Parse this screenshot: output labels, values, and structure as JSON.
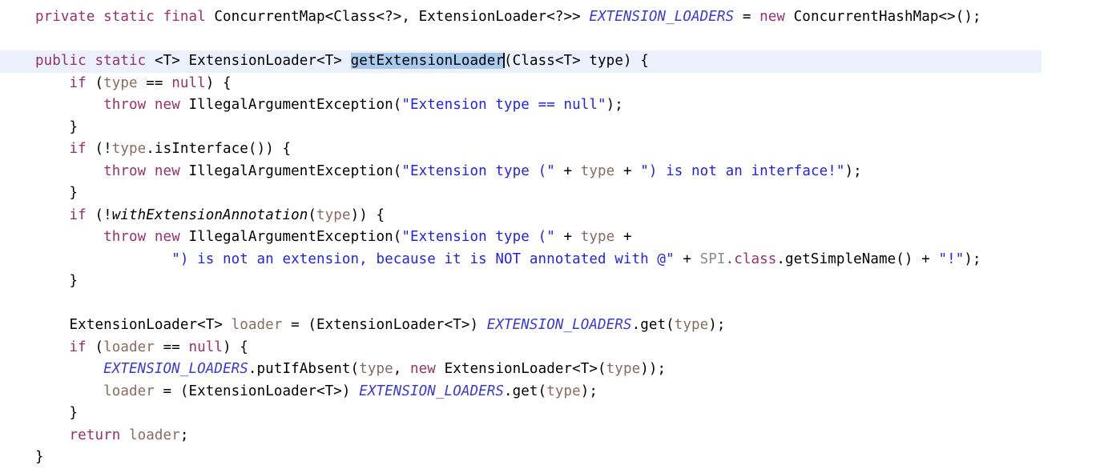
{
  "editor": {
    "language": "java",
    "background_color": "#ffffff",
    "current_line_highlight_color": "#eaf1fb",
    "selection_color": "#a9cbee",
    "caret_color": "#111111",
    "font_size_px": 17.5,
    "colors": {
      "keyword": "#9a2f6a",
      "string": "#2222ee",
      "static_field": "#3b39d6",
      "local_variable": "#8a6a62",
      "class_name": "#000000",
      "constant_class": "#8b8b8b",
      "static_method_italic": "#000000"
    }
  },
  "code": {
    "line1": {
      "kw_private": "private",
      "kw_static": "static",
      "kw_final": "final",
      "type_concurrentmap": "ConcurrentMap<Class<?>, ExtensionLoader<?>>",
      "field_extension_loaders": "EXTENSION_LOADERS",
      "op_assign": "=",
      "kw_new": "new",
      "type_concurrenthashmap": "ConcurrentHashMap<>();"
    },
    "line3": {
      "kw_public": "public",
      "kw_static": "static",
      "generic_t": "<T>",
      "return_type": "ExtensionLoader<T>",
      "method_name": "getExtensionLoader",
      "params": "(Class<T> type) {"
    },
    "line4": {
      "kw_if": "if",
      "open": "(",
      "var_type": "type",
      "op_eq": " == ",
      "kw_null": "null",
      "close": ") {"
    },
    "line5": {
      "kw_throw": "throw",
      "kw_new": "new",
      "exception": "IllegalArgumentException(",
      "string": "\"Extension type == null\"",
      "tail": ");"
    },
    "line6": {
      "close_brace": "}"
    },
    "line7": {
      "kw_if": "if",
      "open": "(!",
      "var_type": "type",
      "call": ".isInterface()) {"
    },
    "line8": {
      "kw_throw": "throw",
      "kw_new": "new",
      "exception": "IllegalArgumentException(",
      "string_a": "\"Extension type (\"",
      "plus1": " + ",
      "var_type": "type",
      "plus2": " + ",
      "string_b": "\") is not an interface!\"",
      "tail": ");"
    },
    "line9": {
      "close_brace": "}"
    },
    "line10": {
      "kw_if": "if",
      "open": "(!",
      "static_method": "withExtensionAnnotation",
      "paren_open": "(",
      "var_type": "type",
      "close": ")) {"
    },
    "line11": {
      "kw_throw": "throw",
      "kw_new": "new",
      "exception": "IllegalArgumentException(",
      "string_a": "\"Extension type (\"",
      "plus1": " + ",
      "var_type": "type",
      "plus2": " +"
    },
    "line12": {
      "string_b": "\") is not an extension, because it is NOT annotated with @\"",
      "plus1": " + ",
      "const_spi": "SPI",
      "kw_class": ".class",
      "call": ".getSimpleName()",
      "plus2": " + ",
      "string_c": "\"!\"",
      "tail": ");"
    },
    "line13": {
      "close_brace": "}"
    },
    "line15": {
      "decl_type": "ExtensionLoader<T>",
      "var_loader": "loader",
      "op_assign": " = ",
      "cast": "(ExtensionLoader<T>)",
      "field_extension_loaders": "EXTENSION_LOADERS",
      "call": ".get(",
      "var_type": "type",
      "tail": ");"
    },
    "line16": {
      "kw_if": "if",
      "open": "(",
      "var_loader": "loader",
      "op_eq": " == ",
      "kw_null": "null",
      "close": ") {"
    },
    "line17": {
      "field_extension_loaders": "EXTENSION_LOADERS",
      "call": ".putIfAbsent(",
      "var_type": "type",
      "comma": ", ",
      "kw_new": "new",
      "ctor": "ExtensionLoader<T>(",
      "var_type2": "type",
      "tail": "));"
    },
    "line18": {
      "var_loader": "loader",
      "op_assign": " = ",
      "cast": "(ExtensionLoader<T>)",
      "field_extension_loaders": "EXTENSION_LOADERS",
      "call": ".get(",
      "var_type": "type",
      "tail": ");"
    },
    "line19": {
      "close_brace": "}"
    },
    "line20": {
      "kw_return": "return",
      "var_loader": "loader",
      "tail": ";"
    },
    "line21": {
      "close_brace": "}"
    }
  }
}
